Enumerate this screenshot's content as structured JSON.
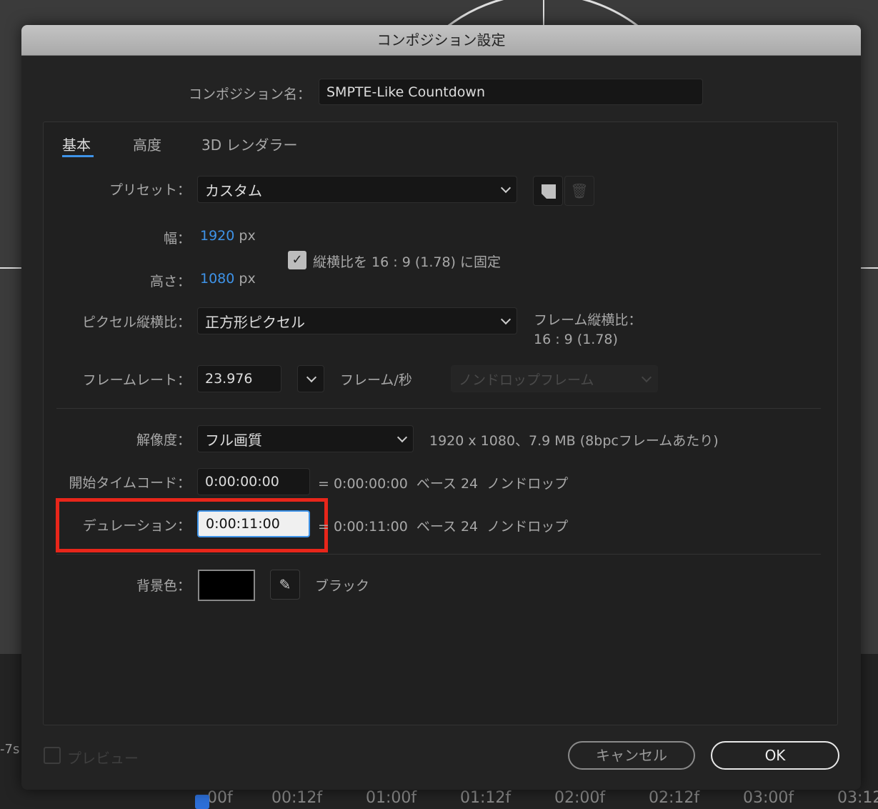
{
  "dialog": {
    "title": "コンポジション設定"
  },
  "comp_name": {
    "label": "コンポジション名：",
    "value": "SMPTE-Like Countdown"
  },
  "tabs": [
    {
      "label": "基本"
    },
    {
      "label": "高度"
    },
    {
      "label": "3D レンダラー"
    }
  ],
  "preset": {
    "label": "プリセット：",
    "value": "カスタム"
  },
  "width": {
    "label": "幅：",
    "value": "1920",
    "unit": "px"
  },
  "height": {
    "label": "高さ：",
    "value": "1080",
    "unit": "px"
  },
  "lock_aspect": {
    "label": "縦横比を 16 : 9 (1.78) に固定",
    "checked": true
  },
  "pixel_aspect": {
    "label": "ピクセル縦横比：",
    "value": "正方形ピクセル"
  },
  "frame_aspect": {
    "label": "フレーム縦横比：",
    "value": "16 : 9 (1.78)"
  },
  "frame_rate": {
    "label": "フレームレート：",
    "value": "23.976",
    "unit": "フレーム/秒",
    "drop": "ノンドロップフレーム"
  },
  "resolution": {
    "label": "解像度：",
    "value": "フル画質",
    "info": "1920 x 1080、7.9 MB (8bpcフレームあたり)"
  },
  "start_tc": {
    "label": "開始タイムコード：",
    "value": "0:00:00:00",
    "info": "= 0:00:00:00  ベース 24  ノンドロップ"
  },
  "duration": {
    "label": "デュレーション：",
    "value": "0:00:11:00",
    "info": "= 0:00:11:00  ベース 24  ノンドロップ"
  },
  "bg_color": {
    "label": "背景色：",
    "name": "ブラック",
    "color": "#000000"
  },
  "preview": {
    "label": "プレビュー"
  },
  "buttons": {
    "cancel": "キャンセル",
    "ok": "OK"
  },
  "timeline": {
    "left": "-7s",
    "ticks": [
      "00f",
      "00:12f",
      "01:00f",
      "01:12f",
      "02:00f",
      "02:12f",
      "03:00f",
      "03:12"
    ]
  },
  "highlight_color": "#e8261a"
}
